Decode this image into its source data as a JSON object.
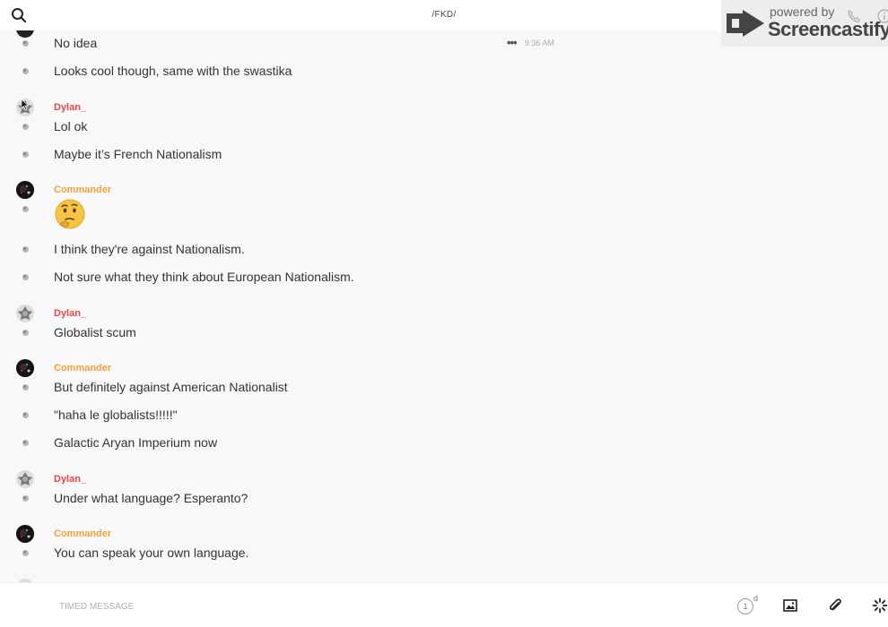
{
  "header": {
    "title": "/FKD/"
  },
  "watermark": {
    "line1": "powered by",
    "line2": "Screencastify"
  },
  "colors": {
    "dylan": "#e0464b",
    "commander": "#f0a13c"
  },
  "messages": [
    {
      "type": "text",
      "text": "No idea",
      "more": "•••",
      "time": "9:36 AM"
    },
    {
      "type": "text",
      "text": "Looks cool though, same with the swastika"
    },
    {
      "type": "author",
      "name": "Dylan_"
    },
    {
      "type": "text",
      "text": "Lol ok"
    },
    {
      "type": "text",
      "text": "Maybe it’s French Nationalism"
    },
    {
      "type": "author",
      "name": "Commander"
    },
    {
      "type": "emoji",
      "icon": "thinking-face-emoji"
    },
    {
      "type": "text",
      "text": "I think they're against Nationalism."
    },
    {
      "type": "text",
      "text": "Not sure what they think about European Nationalism."
    },
    {
      "type": "author",
      "name": "Dylan_"
    },
    {
      "type": "text",
      "text": "Globalist scum"
    },
    {
      "type": "author",
      "name": "Commander"
    },
    {
      "type": "text",
      "text": "But definitely against American Nationalist"
    },
    {
      "type": "text",
      "text": "\"haha le globalists!!!!!\""
    },
    {
      "type": "text",
      "text": "Galactic Aryan Imperium now"
    },
    {
      "type": "author",
      "name": "Dylan_"
    },
    {
      "type": "text",
      "text": "Under what language? Esperanto?"
    },
    {
      "type": "author",
      "name": "Commander"
    },
    {
      "type": "text",
      "text": "You can speak your own language."
    }
  ],
  "composer": {
    "placeholder": "TIMED MESSAGE",
    "timer_value": "1",
    "timer_unit": "d"
  }
}
